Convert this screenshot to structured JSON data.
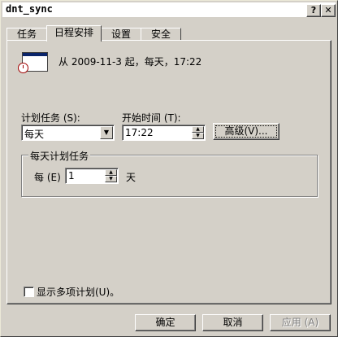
{
  "window": {
    "title": "dnt_sync",
    "help_button": "?",
    "close_button": "✕"
  },
  "tabs": [
    {
      "label": "任务",
      "active": false
    },
    {
      "label": "日程安排",
      "active": true
    },
    {
      "label": "设置",
      "active": false
    },
    {
      "label": "安全",
      "active": false
    }
  ],
  "summary": "从 2009-11-3 起，每天，17:22",
  "schedule": {
    "label": "计划任务 (S):",
    "value": "每天",
    "icon": "dropdown-arrow"
  },
  "start_time": {
    "label": "开始时间 (T):",
    "value": "17:22"
  },
  "advanced_button": "高级(V)...",
  "group": {
    "title": "每天计划任务",
    "every_label": "每 (E)",
    "every_value": "1",
    "unit": "天"
  },
  "show_multiple": {
    "label": "显示多项计划(U)。",
    "checked": false
  },
  "buttons": {
    "ok": "确定",
    "cancel": "取消",
    "apply": "应用 (A)"
  }
}
